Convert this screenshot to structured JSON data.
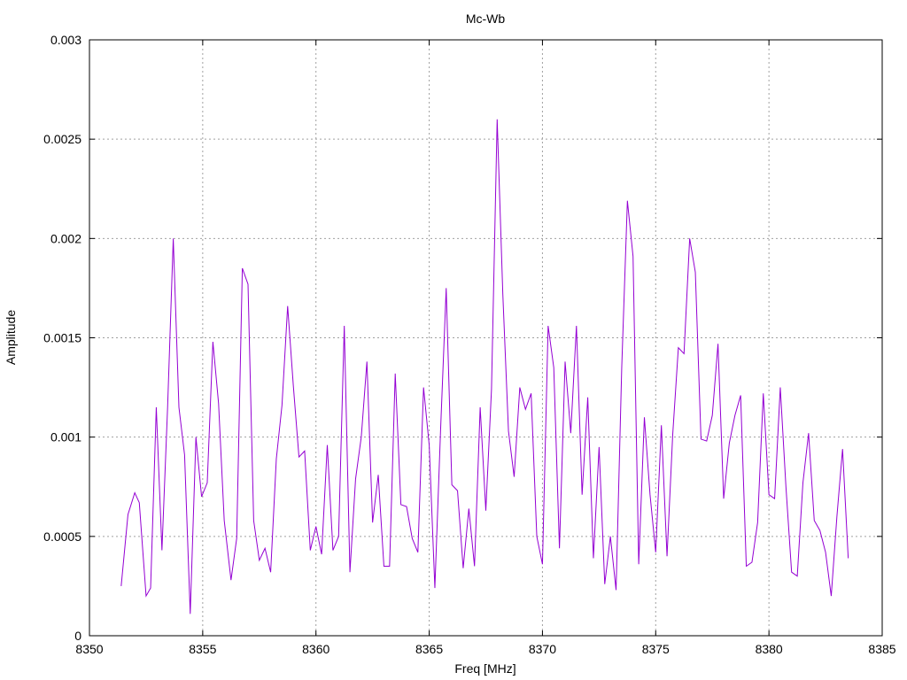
{
  "chart_data": {
    "type": "line",
    "title": "Mc-Wb",
    "xlabel": "Freq [MHz]",
    "ylabel": "Amplitude",
    "xlim": [
      8350,
      8385
    ],
    "ylim": [
      0,
      0.003
    ],
    "xticks": [
      8350,
      8355,
      8360,
      8365,
      8370,
      8375,
      8380,
      8385
    ],
    "xtick_labels": [
      "8350",
      "8355",
      "8360",
      "8365",
      "8370",
      "8375",
      "8380",
      "8385"
    ],
    "yticks": [
      0,
      0.0005,
      0.001,
      0.0015,
      0.002,
      0.0025,
      0.003
    ],
    "ytick_labels": [
      "0",
      "0.0005",
      "0.001",
      "0.0015",
      "0.002",
      "0.0025",
      "0.003"
    ],
    "grid": true,
    "legend": "none",
    "series": [
      {
        "color": "#9400d3",
        "x": [
          8351.4,
          8351.7,
          8352.0,
          8352.2,
          8352.5,
          8352.7,
          8352.95,
          8353.2,
          8353.45,
          8353.7,
          8353.95,
          8354.2,
          8354.45,
          8354.7,
          8354.95,
          8355.2,
          8355.45,
          8355.7,
          8355.95,
          8356.25,
          8356.5,
          8356.75,
          8357.0,
          8357.25,
          8357.5,
          8357.75,
          8358.0,
          8358.25,
          8358.5,
          8358.75,
          8359.0,
          8359.25,
          8359.5,
          8359.75,
          8360.0,
          8360.25,
          8360.5,
          8360.75,
          8361.0,
          8361.25,
          8361.5,
          8361.75,
          8362.0,
          8362.25,
          8362.5,
          8362.75,
          8363.0,
          8363.25,
          8363.5,
          8363.75,
          8364.0,
          8364.25,
          8364.5,
          8364.75,
          8365.0,
          8365.25,
          8365.5,
          8365.75,
          8366.0,
          8366.25,
          8366.5,
          8366.75,
          8367.0,
          8367.25,
          8367.5,
          8367.75,
          8368.0,
          8368.25,
          8368.5,
          8368.75,
          8369.0,
          8369.25,
          8369.5,
          8369.75,
          8370.0,
          8370.25,
          8370.5,
          8370.75,
          8371.0,
          8371.25,
          8371.5,
          8371.75,
          8372.0,
          8372.25,
          8372.5,
          8372.75,
          8373.0,
          8373.25,
          8373.5,
          8373.75,
          8374.0,
          8374.25,
          8374.5,
          8374.75,
          8375.0,
          8375.25,
          8375.5,
          8375.75,
          8376.0,
          8376.25,
          8376.5,
          8376.75,
          8377.0,
          8377.25,
          8377.5,
          8377.75,
          8378.0,
          8378.25,
          8378.5,
          8378.75,
          8379.0,
          8379.25,
          8379.5,
          8379.75,
          8380.0,
          8380.25,
          8380.5,
          8380.75,
          8381.0,
          8381.25,
          8381.5,
          8381.75,
          8382.0,
          8382.25,
          8382.5,
          8382.75,
          8383.0,
          8383.25,
          8383.5
        ],
        "y": [
          0.00025,
          0.00061,
          0.00072,
          0.00067,
          0.0002,
          0.00024,
          0.00115,
          0.00043,
          0.00115,
          0.002,
          0.00115,
          0.00091,
          0.00011,
          0.001,
          0.0007,
          0.00077,
          0.00148,
          0.00117,
          0.00058,
          0.00028,
          0.00049,
          0.00185,
          0.00177,
          0.00058,
          0.00038,
          0.00044,
          0.00032,
          0.00089,
          0.00116,
          0.00166,
          0.00126,
          0.0009,
          0.00093,
          0.00043,
          0.00055,
          0.00041,
          0.00096,
          0.00043,
          0.0005,
          0.00156,
          0.00032,
          0.00079,
          0.001,
          0.00138,
          0.00057,
          0.00081,
          0.00035,
          0.00035,
          0.00132,
          0.00066,
          0.00065,
          0.00049,
          0.00042,
          0.00125,
          0.00096,
          0.00024,
          0.00103,
          0.00175,
          0.00076,
          0.00073,
          0.00034,
          0.00064,
          0.00035,
          0.00115,
          0.00063,
          0.00124,
          0.0026,
          0.00172,
          0.00103,
          0.0008,
          0.00125,
          0.00114,
          0.00122,
          0.0005,
          0.00036,
          0.00156,
          0.00135,
          0.00044,
          0.00138,
          0.00102,
          0.00156,
          0.00071,
          0.0012,
          0.00039,
          0.00095,
          0.00026,
          0.0005,
          0.00023,
          0.00135,
          0.00219,
          0.00191,
          0.00036,
          0.0011,
          0.00071,
          0.00042,
          0.00106,
          0.0004,
          0.00101,
          0.00145,
          0.00142,
          0.002,
          0.00183,
          0.00099,
          0.00098,
          0.00111,
          0.00147,
          0.00069,
          0.00097,
          0.00111,
          0.00121,
          0.00035,
          0.00037,
          0.00057,
          0.00122,
          0.00071,
          0.00069,
          0.00125,
          0.00075,
          0.00032,
          0.0003,
          0.00077,
          0.00102,
          0.00058,
          0.00053,
          0.00042,
          0.0002,
          0.0006,
          0.00094,
          0.00039
        ]
      }
    ]
  }
}
